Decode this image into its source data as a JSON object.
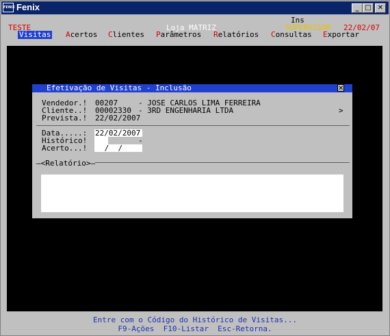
{
  "window": {
    "title": "Fenix",
    "icon_text": "FENIX",
    "min_symbol": "_",
    "max_symbol": "□",
    "close_symbol": "✕"
  },
  "header": {
    "env": "TESTE",
    "store": "Loja MATRIZ",
    "mode": "Ins",
    "user": "SUPERVISOR",
    "date": "22/02/07"
  },
  "menu": [
    {
      "hot": "V",
      "rest": "isitas",
      "active": true
    },
    {
      "hot": "A",
      "rest": "certos"
    },
    {
      "hot": "C",
      "rest": "lientes"
    },
    {
      "hot": "P",
      "rest": "arâmetros"
    },
    {
      "hot": "R",
      "rest": "elatórios"
    },
    {
      "hot": "C",
      "rest": "onsultas"
    },
    {
      "hot": "E",
      "rest": "xportar"
    }
  ],
  "dialog": {
    "title": "Efetivação de Visitas - Inclusão",
    "close": "✕",
    "vendedor_label": "Vendedor.!",
    "vendedor_code": "00207",
    "vendedor_name": "- JOSE CARLOS LIMA FERREIRA",
    "cliente_label": "Cliente..!",
    "cliente_code": "00002330",
    "cliente_name": "- 3RD ENGENHARIA LTDA",
    "cliente_arrow": ">",
    "prevista_label": "Prevista.!",
    "prevista_value": "22/02/2007",
    "data_label": "Data.....:",
    "data_value": "22/02/2007",
    "historico_label": "Histórico!",
    "historico_dash": "-",
    "acerto_label": "Acerto...!",
    "acerto_value": " /  /",
    "relatorio_label": "—<Relatório>—"
  },
  "status": {
    "line1": "Entre com o Código do Histórico de Visitas...",
    "line2": "F9-Ações  F10-Listar  Esc-Retorna."
  }
}
